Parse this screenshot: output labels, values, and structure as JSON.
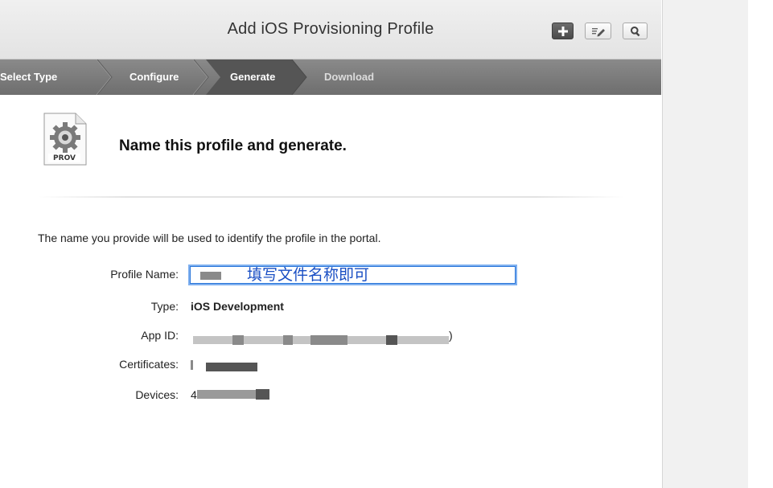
{
  "header": {
    "title": "Add iOS Provisioning Profile",
    "buttons": [
      "add-icon",
      "edit-icon",
      "search-icon"
    ]
  },
  "steps": [
    {
      "label": "Select Type",
      "state": "done"
    },
    {
      "label": "Configure",
      "state": "done"
    },
    {
      "label": "Generate",
      "state": "current"
    },
    {
      "label": "Download",
      "state": "upcoming"
    }
  ],
  "content": {
    "icon_label": "PROV",
    "heading": "Name this profile and generate.",
    "intro": "The name you provide will be used to identify the profile in the portal.",
    "form": {
      "profile_name_label": "Profile Name:",
      "profile_name_value": "填写文件名称即可",
      "type_label": "Type:",
      "type_value": "iOS Development",
      "app_id_label": "App ID:",
      "app_id_suffix": ")",
      "certificates_label": "Certificates:",
      "devices_label": "Devices:",
      "devices_prefix": "4"
    }
  },
  "colors": {
    "steps_bar": "#7a7a7a",
    "current_step": "#5a5a5a",
    "input_focus": "#2a76d9",
    "input_text": "#1a4fc4"
  }
}
